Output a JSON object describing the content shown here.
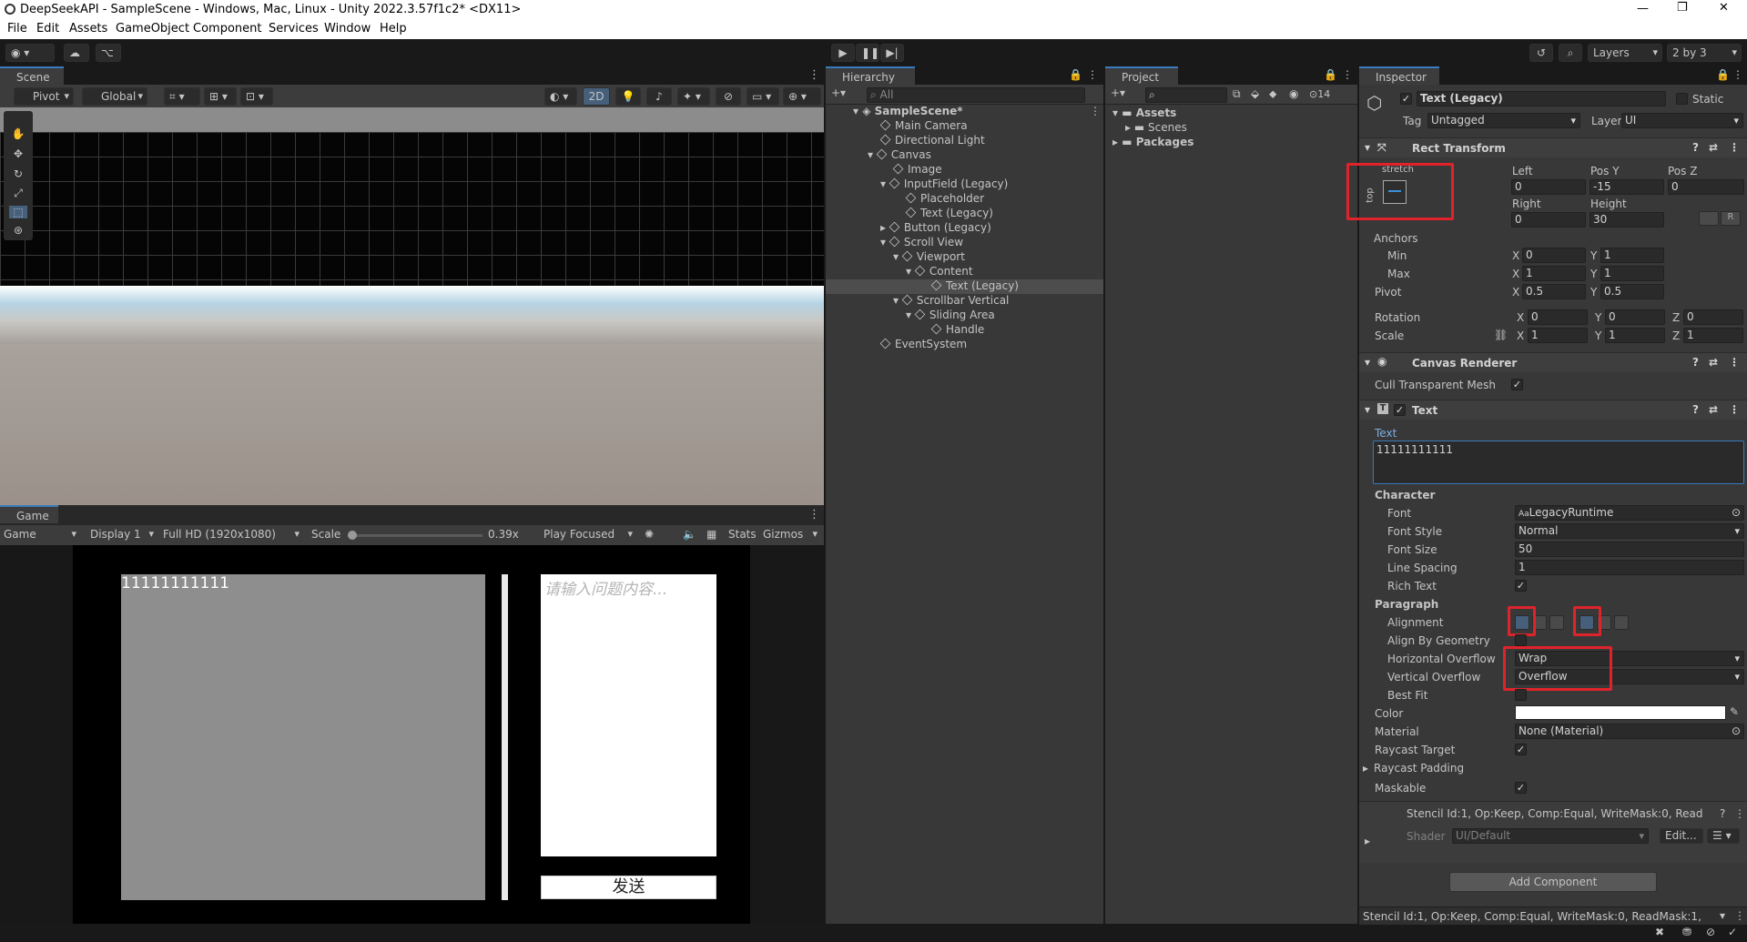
{
  "window": {
    "title": "DeepSeekAPI - SampleScene - Windows, Mac, Linux - Unity 2022.3.57f1c2* <DX11>"
  },
  "menu": [
    "File",
    "Edit",
    "Assets",
    "GameObject",
    "Component",
    "Services",
    "Window",
    "Help"
  ],
  "toolbar": {
    "layers": "Layers",
    "layout": "2 by 3"
  },
  "scene": {
    "tab": "Scene",
    "pivot": "Pivot",
    "global": "Global",
    "mode2d": "2D"
  },
  "game": {
    "tab": "Game",
    "mode": "Game",
    "display": "Display 1",
    "resolution": "Full HD (1920x1080)",
    "scale_label": "Scale",
    "scale_value": "0.39x",
    "play_focused": "Play Focused",
    "stats": "Stats",
    "gizmos": "Gizmos",
    "output_text": "11111111111",
    "input_placeholder": "请输入问题内容...",
    "send_button": "发送"
  },
  "hierarchy": {
    "tab": "Hierarchy",
    "search_placeholder": "All",
    "items": [
      {
        "label": "SampleScene*",
        "indent": 0
      },
      {
        "label": "Main Camera",
        "indent": 1
      },
      {
        "label": "Directional Light",
        "indent": 1
      },
      {
        "label": "Canvas",
        "indent": 1
      },
      {
        "label": "Image",
        "indent": 2
      },
      {
        "label": "InputField (Legacy)",
        "indent": 2
      },
      {
        "label": "Placeholder",
        "indent": 3
      },
      {
        "label": "Text (Legacy)",
        "indent": 3
      },
      {
        "label": "Button (Legacy)",
        "indent": 2
      },
      {
        "label": "Scroll View",
        "indent": 2
      },
      {
        "label": "Viewport",
        "indent": 3
      },
      {
        "label": "Content",
        "indent": 4
      },
      {
        "label": "Text (Legacy)",
        "indent": 5
      },
      {
        "label": "Scrollbar Vertical",
        "indent": 3
      },
      {
        "label": "Sliding Area",
        "indent": 4
      },
      {
        "label": "Handle",
        "indent": 5
      },
      {
        "label": "EventSystem",
        "indent": 1
      }
    ]
  },
  "project": {
    "tab": "Project",
    "badge": "14",
    "folders": [
      "Assets",
      "Scenes",
      "Packages"
    ]
  },
  "inspector": {
    "tab": "Inspector",
    "object_name": "Text (Legacy)",
    "static_label": "Static",
    "tag_label": "Tag",
    "tag_value": "Untagged",
    "layer_label": "Layer",
    "layer_value": "UI",
    "rect_transform": {
      "title": "Rect Transform",
      "anchor_preset_h": "stretch",
      "anchor_preset_v": "top",
      "left_label": "Left",
      "left": "0",
      "posy_label": "Pos Y",
      "posy": "-15",
      "posz_label": "Pos Z",
      "posz": "0",
      "right_label": "Right",
      "right": "0",
      "height_label": "Height",
      "height": "30",
      "anchors_label": "Anchors",
      "min_label": "Min",
      "min_x": "0",
      "min_y": "1",
      "max_label": "Max",
      "max_x": "1",
      "max_y": "1",
      "pivot_label": "Pivot",
      "pivot_x": "0.5",
      "pivot_y": "0.5",
      "rotation_label": "Rotation",
      "rot_x": "0",
      "rot_y": "0",
      "rot_z": "0",
      "scale_label": "Scale",
      "scale_x": "1",
      "scale_y": "1",
      "scale_z": "1",
      "x": "X",
      "y": "Y",
      "z": "Z",
      "r": "R"
    },
    "canvas_renderer": {
      "title": "Canvas Renderer",
      "cull_label": "Cull Transparent Mesh"
    },
    "text": {
      "title": "Text",
      "text_label": "Text",
      "text_value": "11111111111",
      "character_label": "Character",
      "font_label": "Font",
      "font_value": "LegacyRuntime",
      "font_style_label": "Font Style",
      "font_style": "Normal",
      "font_size_label": "Font Size",
      "font_size": "50",
      "line_spacing_label": "Line Spacing",
      "line_spacing": "1",
      "rich_text_label": "Rich Text",
      "paragraph_label": "Paragraph",
      "alignment_label": "Alignment",
      "align_geometry_label": "Align By Geometry",
      "h_overflow_label": "Horizontal Overflow",
      "h_overflow": "Wrap",
      "v_overflow_label": "Vertical Overflow",
      "v_overflow": "Overflow",
      "best_fit_label": "Best Fit",
      "color_label": "Color",
      "material_label": "Material",
      "material_value": "None (Material)",
      "raycast_target_label": "Raycast Target",
      "raycast_padding_label": "Raycast Padding",
      "maskable_label": "Maskable"
    },
    "stencil_info": "Stencil Id:1, Op:Keep, Comp:Equal, WriteMask:0, Read",
    "shader_label": "Shader",
    "shader_value": "UI/Default",
    "edit_button": "Edit...",
    "add_component": "Add Component",
    "status": "Stencil Id:1, Op:Keep, Comp:Equal, WriteMask:0, ReadMask:1,"
  }
}
